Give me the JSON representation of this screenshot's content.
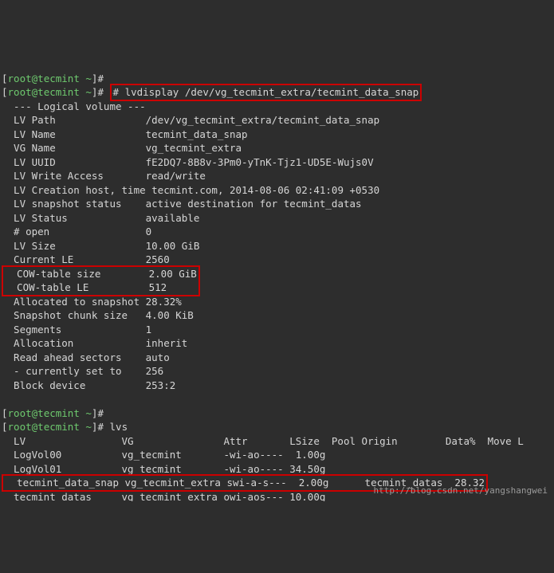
{
  "prompt": {
    "user": "root",
    "host": "tecmint",
    "path": "~",
    "symbol": "#"
  },
  "commands": {
    "empty1": "",
    "lvdisplay": "# lvdisplay /dev/vg_tecmint_extra/tecmint_data_snap",
    "lvs": "lvs"
  },
  "lv": {
    "header": "  --- Logical volume ---",
    "path_label": "  LV Path               ",
    "path_val": "/dev/vg_tecmint_extra/tecmint_data_snap",
    "name_label": "  LV Name               ",
    "name_val": "tecmint_data_snap",
    "vg_label": "  VG Name               ",
    "vg_val": "vg_tecmint_extra",
    "uuid_label": "  LV UUID               ",
    "uuid_val": "fE2DQ7-8B8v-3Pm0-yTnK-Tjz1-UD5E-Wujs0V",
    "wa_label": "  LV Write Access       ",
    "wa_val": "read/write",
    "host_label": "  LV Creation host, time ",
    "host_val": "tecmint.com, 2014-08-06 02:41:09 +0530",
    "ss_label": "  LV snapshot status    ",
    "ss_val": "active destination for tecmint_datas",
    "status_label": "  LV Status             ",
    "status_val": "available",
    "open_label": "  # open                ",
    "open_val": "0",
    "size_label": "  LV Size               ",
    "size_val": "10.00 GiB",
    "le_label": "  Current LE            ",
    "le_val": "2560",
    "cowts_label": "  COW-table size        ",
    "cowts_val": "2.00 GiB",
    "cowle_label": "  COW-table LE          ",
    "cowle_val": "512",
    "alloc_label": "  Allocated to snapshot ",
    "alloc_val": "28.32%",
    "chunk_label": "  Snapshot chunk size   ",
    "chunk_val": "4.00 KiB",
    "seg_label": "  Segments              ",
    "seg_val": "1",
    "allocn_label": "  Allocation            ",
    "allocn_val": "inherit",
    "ras_label": "  Read ahead sectors    ",
    "ras_val": "auto",
    "cur_label": "  - currently set to    ",
    "cur_val": "256",
    "blk_label": "  Block device          ",
    "blk_val": "253:2"
  },
  "lvs": {
    "header": "  LV                VG               Attr       LSize  Pool Origin        Data%  Move L",
    "row1": "  LogVol00          vg_tecmint       -wi-ao----  1.00g",
    "row2": "  LogVol01          vg_tecmint       -wi-ao---- 34.50g",
    "row3": "  tecmint_data_snap vg_tecmint_extra swi-a-s---  2.00g      tecmint_datas  28.32",
    "row4": "  tecmint_datas     vg_tecmint_extra owi-aos--- 10.00g"
  },
  "watermark": "http://blog.csdn.net/yangshangwei"
}
